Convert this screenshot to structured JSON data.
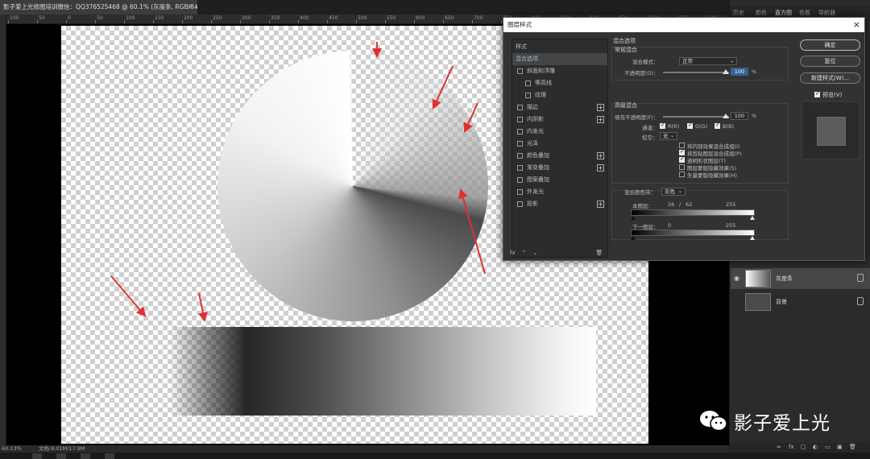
{
  "document": {
    "tab_title": "影子爱上光修图培训微信：QQ376525468 @ 60.1% (灰度条, RGB/8#) *",
    "close_glyph": "×"
  },
  "ruler": {
    "ticks": [
      "100",
      "50",
      "0",
      "50",
      "100",
      "150",
      "200",
      "250",
      "300",
      "350",
      "400",
      "450",
      "500",
      "550",
      "600",
      "650",
      "700",
      "750",
      "800",
      "850",
      "900",
      "950",
      "1000",
      "1050",
      "1100",
      "1150"
    ]
  },
  "right_panel": {
    "tabs": [
      "历史",
      "颜色",
      "直方图",
      "色板",
      "导航器"
    ],
    "active_tab": "直方图",
    "layers": [
      {
        "name": "灰度条",
        "selected": true
      },
      {
        "name": "背景",
        "selected": false
      }
    ],
    "footer_icons": [
      "∞",
      "fx",
      "□",
      "◐",
      "▭",
      "▣",
      "🗑"
    ]
  },
  "watermark": {
    "text": "影子爱上光"
  },
  "status_bar": {
    "zoom": "60.13%",
    "doc_size": "文档:9.01M/17.9M"
  },
  "dialog": {
    "title": "图层样式",
    "close_glyph": "×",
    "styles_header": "样式",
    "style_items": [
      {
        "label": "混合选项",
        "checkbox": false,
        "plus": false,
        "active": true,
        "indent": 0
      },
      {
        "label": "斜面和浮雕",
        "checkbox": true,
        "plus": false,
        "active": false,
        "indent": 0
      },
      {
        "label": "等高线",
        "checkbox": true,
        "plus": false,
        "active": false,
        "indent": 1
      },
      {
        "label": "纹理",
        "checkbox": true,
        "plus": false,
        "active": false,
        "indent": 1
      },
      {
        "label": "描边",
        "checkbox": true,
        "plus": true,
        "active": false,
        "indent": 0
      },
      {
        "label": "内阴影",
        "checkbox": true,
        "plus": true,
        "active": false,
        "indent": 0
      },
      {
        "label": "内发光",
        "checkbox": true,
        "plus": false,
        "active": false,
        "indent": 0
      },
      {
        "label": "光泽",
        "checkbox": true,
        "plus": false,
        "active": false,
        "indent": 0
      },
      {
        "label": "颜色叠加",
        "checkbox": true,
        "plus": true,
        "active": false,
        "indent": 0
      },
      {
        "label": "渐变叠加",
        "checkbox": true,
        "plus": true,
        "active": false,
        "indent": 0
      },
      {
        "label": "图案叠加",
        "checkbox": true,
        "plus": false,
        "active": false,
        "indent": 0
      },
      {
        "label": "外发光",
        "checkbox": true,
        "plus": false,
        "active": false,
        "indent": 0
      },
      {
        "label": "投影",
        "checkbox": true,
        "plus": true,
        "active": false,
        "indent": 0
      }
    ],
    "style_footer": [
      "fx",
      "⌃",
      "⌄",
      "🗑"
    ],
    "blending_options_title": "混合选项",
    "general_blending": {
      "title": "常规混合",
      "mode_label": "混合模式：",
      "mode_value": "正常",
      "opacity_label": "不透明度(O)：",
      "opacity_value": "100",
      "opacity_unit": "%"
    },
    "advanced_blending": {
      "title": "高级混合",
      "fill_opacity_label": "填充不透明度(F)：",
      "fill_opacity_value": "100",
      "fill_unit": "%",
      "channels_label": "通道：",
      "channels": [
        "R(R)",
        "G(G)",
        "B(B)"
      ],
      "knockout_label": "挖空：",
      "knockout_value": "无",
      "options": [
        {
          "label": "将内部效果混合成组(I)",
          "checked": false
        },
        {
          "label": "将剪贴图层混合成组(P)",
          "checked": true
        },
        {
          "label": "透明形状图层(T)",
          "checked": true
        },
        {
          "label": "图层蒙版隐藏效果(S)",
          "checked": false
        },
        {
          "label": "矢量蒙版隐藏效果(H)",
          "checked": false
        }
      ]
    },
    "blend_if": {
      "label": "混合颜色带：",
      "value": "灰色",
      "this_layer_label": "本图层：",
      "this_layer_values": [
        "26",
        "/",
        "62",
        "255"
      ],
      "underlying_label": "下一图层：",
      "underlying_values": [
        "0",
        "255"
      ]
    },
    "buttons": {
      "ok": "确定",
      "reset": "复位",
      "new_style": "新建样式(W)...",
      "preview_label": "预览(V)"
    }
  }
}
